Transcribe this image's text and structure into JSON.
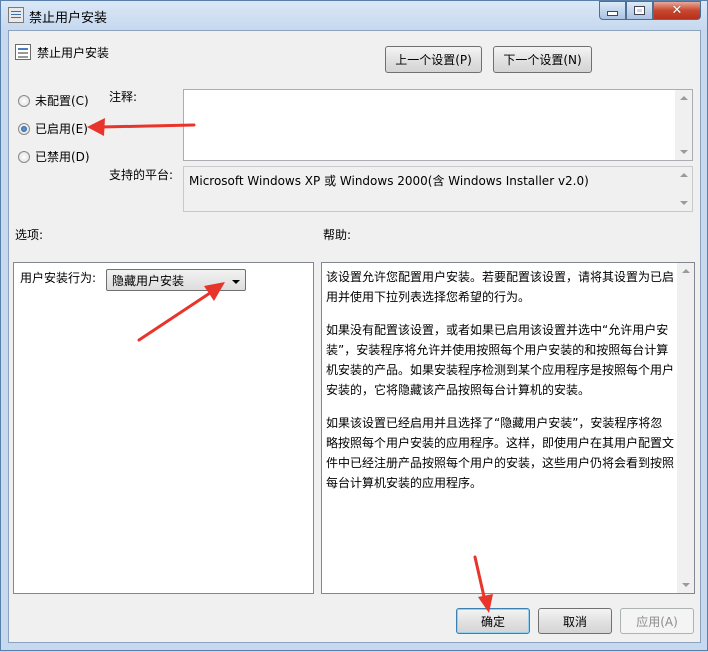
{
  "window": {
    "title": "禁止用户安装"
  },
  "header": {
    "policy_name": "禁止用户安装",
    "prev_button": "上一个设置(P)",
    "next_button": "下一个设置(N)"
  },
  "state": {
    "options": [
      {
        "label": "未配置(C)",
        "checked": false
      },
      {
        "label": "已启用(E)",
        "checked": true
      },
      {
        "label": "已禁用(D)",
        "checked": false
      }
    ]
  },
  "comment": {
    "label": "注释:",
    "value": ""
  },
  "platform": {
    "label": "支持的平台:",
    "value": "Microsoft Windows XP 或 Windows 2000(含 Windows Installer v2.0)"
  },
  "options_section": {
    "label": "选项:",
    "field_label": "用户安装行为:",
    "selected_value": "隐藏用户安装"
  },
  "help_section": {
    "label": "帮助:",
    "paragraphs": [
      "该设置允许您配置用户安装。若要配置该设置，请将其设置为已启用并使用下拉列表选择您希望的行为。",
      "如果没有配置该设置，或者如果已启用该设置并选中“允许用户安装”，安装程序将允许并使用按照每个用户安装的和按照每台计算机安装的产品。如果安装程序检测到某个应用程序是按照每个用户安装的，它将隐藏该产品按照每台计算机的安装。",
      "如果该设置已经启用并且选择了“隐藏用户安装”，安装程序将忽略按照每个用户安装的应用程序。这样，即使用户在其用户配置文件中已经注册产品按照每个用户的安装，这些用户仍将会看到按照每台计算机安装的应用程序。"
    ]
  },
  "footer": {
    "ok": "确定",
    "cancel": "取消",
    "apply": "应用(A)"
  },
  "colors": {
    "annotation_arrow": "#e8352b",
    "accent": "#3c7fb1"
  }
}
